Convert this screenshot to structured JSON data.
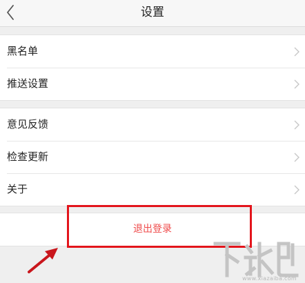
{
  "header": {
    "title": "设置",
    "back_icon": "chevron-left-icon"
  },
  "groups": [
    {
      "items": [
        {
          "label": "黑名单"
        },
        {
          "label": "推送设置"
        }
      ]
    },
    {
      "items": [
        {
          "label": "意见反馈"
        },
        {
          "label": "检查更新"
        },
        {
          "label": "关于"
        }
      ]
    }
  ],
  "logout": {
    "label": "退出登录",
    "color": "#ef4a4a"
  },
  "annotation": {
    "box_color": "#e3141b"
  },
  "watermark": {
    "text": "下载吧",
    "url": "www.xiazaiba.com"
  }
}
